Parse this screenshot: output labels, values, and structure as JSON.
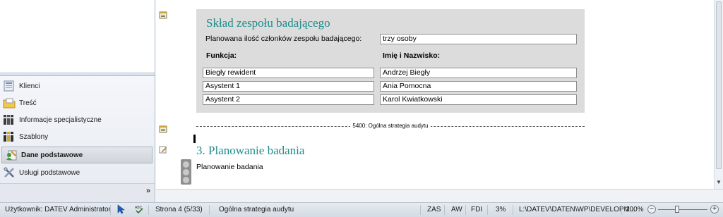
{
  "nav": {
    "items": [
      {
        "label": "Klienci",
        "icon": "clients-icon"
      },
      {
        "label": "Treść",
        "icon": "folder-icon"
      },
      {
        "label": "Informacje specjalistyczne",
        "icon": "binders-icon"
      },
      {
        "label": "Szablony",
        "icon": "templates-binders-icon"
      },
      {
        "label": "Dane podstawowe",
        "icon": "master-data-icon"
      },
      {
        "label": "Usługi podstawowe",
        "icon": "tools-icon"
      }
    ],
    "expand_label": "»"
  },
  "document": {
    "team_section": {
      "title": "Skład zespołu badającego",
      "planned_label": "Planowana ilość członków zespołu badającego:",
      "planned_value": "trzy osoby",
      "col_function": "Funkcja:",
      "col_name": "Imię i Nazwisko:",
      "rows": [
        {
          "function": "Biegły rewident",
          "name": "Andrzej Biegły"
        },
        {
          "function": "Asystent 1",
          "name": "Ania Pomocna"
        },
        {
          "function": "Asystent 2",
          "name": "Karol Kwiatkowski"
        }
      ]
    },
    "separator_text": "5400: Ogólna strategia audytu",
    "section_title": "3. Planowanie badania",
    "section_subtitle": "Planowanie badania"
  },
  "status": {
    "user": "Użytkownik:  DATEV Administrator",
    "page": "Strona 4 (5/33)",
    "section": "Ogólna strategia audytu",
    "zas": "ZAS",
    "aw": "AW",
    "fdi": "FDI",
    "percent": "3%",
    "path": "L:\\DATEV\\DATEN\\WP\\DEVELOPM...",
    "zoom": "100%",
    "zoom_minus": "−",
    "zoom_plus": "+"
  },
  "colors": {
    "heading": "#1d8c8c",
    "panel": "#dcdcdc"
  }
}
